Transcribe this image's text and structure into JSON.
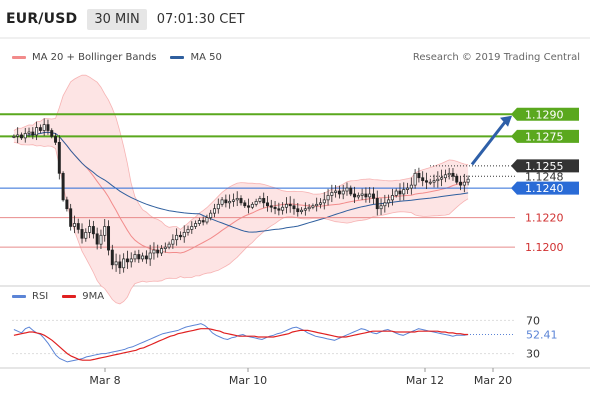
{
  "header": {
    "symbol": "EUR/USD",
    "timeframe": "30 MIN",
    "time": "07:01:30 CET"
  },
  "legend": {
    "bollinger_label": "MA 20 + Bollinger Bands",
    "ma50_label": "MA 50",
    "rsi_label": "RSI",
    "ma9_label": "9MA"
  },
  "credit": "Research © 2019 Trading Central",
  "colors": {
    "bollinger": "#f28b8b",
    "bollinger_fill": "#fde4e4",
    "ma50": "#2f5f9e",
    "resistance": "#5aa81e",
    "support": "#e88b8b",
    "pivot": "#2a6bd6",
    "arrow": "#2e5fa8",
    "rsi": "#5b84d6",
    "rsi_ma": "#e02020",
    "candle": "#222222"
  },
  "chart_data": [
    {
      "type": "candlestick",
      "title": "",
      "x_ticks": [
        "Mar 8",
        "Mar 10",
        "Mar 12",
        "Mar 20"
      ],
      "y_range": [
        1.1175,
        1.132
      ],
      "closes": [
        1.1275,
        1.1276,
        1.1274,
        1.1277,
        1.1278,
        1.1276,
        1.1281,
        1.1279,
        1.1283,
        1.1279,
        1.1275,
        1.1271,
        1.125,
        1.1232,
        1.1226,
        1.1214,
        1.1216,
        1.1212,
        1.1206,
        1.121,
        1.1214,
        1.1209,
        1.1202,
        1.1208,
        1.1214,
        1.1198,
        1.1188,
        1.119,
        1.1186,
        1.1192,
        1.119,
        1.1192,
        1.1195,
        1.1192,
        1.1194,
        1.1192,
        1.1196,
        1.1198,
        1.1196,
        1.1199,
        1.12,
        1.1202,
        1.1205,
        1.1208,
        1.1207,
        1.121,
        1.1212,
        1.1214,
        1.1216,
        1.1218,
        1.1217,
        1.122,
        1.1223,
        1.1226,
        1.1229,
        1.1232,
        1.123,
        1.1231,
        1.1232,
        1.1233,
        1.123,
        1.1228,
        1.1227,
        1.1229,
        1.1231,
        1.1233,
        1.123,
        1.1228,
        1.1227,
        1.1226,
        1.1225,
        1.1227,
        1.1229,
        1.1228,
        1.1226,
        1.1224,
        1.1225,
        1.1226,
        1.1227,
        1.1228,
        1.1229,
        1.123,
        1.1232,
        1.1235,
        1.1237,
        1.1238,
        1.1236,
        1.1238,
        1.124,
        1.1236,
        1.1234,
        1.1235,
        1.1236,
        1.1234,
        1.1236,
        1.1233,
        1.1226,
        1.1228,
        1.123,
        1.1232,
        1.1235,
        1.1238,
        1.1236,
        1.1239,
        1.124,
        1.1242,
        1.125,
        1.1247,
        1.1245,
        1.1244,
        1.1244,
        1.1245,
        1.1246,
        1.1247,
        1.1249,
        1.125,
        1.1248,
        1.1244,
        1.1242,
        1.1244,
        1.1246
      ],
      "price_lines": [
        {
          "label": "1.1290",
          "value": 1.129,
          "kind": "resistance"
        },
        {
          "label": "1.1275",
          "value": 1.1275,
          "kind": "resistance"
        },
        {
          "label": "1.1255",
          "value": 1.1255,
          "kind": "last"
        },
        {
          "label": "1.1248",
          "value": 1.1248,
          "kind": "dotted"
        },
        {
          "label": "1.1240",
          "value": 1.124,
          "kind": "pivot"
        },
        {
          "label": "1.1220",
          "value": 1.122,
          "kind": "support"
        },
        {
          "label": "1.1200",
          "value": 1.12,
          "kind": "support"
        }
      ],
      "series": [
        {
          "name": "MA 20 + Bollinger Bands"
        },
        {
          "name": "MA 50"
        }
      ]
    },
    {
      "type": "line",
      "title": "",
      "y_range": [
        15,
        85
      ],
      "y_ticks": [
        "70",
        "30"
      ],
      "last_value": "52.41",
      "series": [
        {
          "name": "RSI",
          "values": [
            59,
            57,
            55,
            60,
            62,
            58,
            55,
            53,
            48,
            42,
            35,
            28,
            24,
            22,
            20,
            21,
            22,
            23,
            24,
            26,
            27,
            28,
            29,
            30,
            30,
            31,
            32,
            33,
            34,
            35,
            37,
            38,
            40,
            42,
            44,
            46,
            48,
            50,
            52,
            54,
            55,
            56,
            57,
            58,
            60,
            62,
            63,
            64,
            65,
            66,
            64,
            60,
            55,
            52,
            50,
            48,
            47,
            49,
            50,
            52,
            53,
            51,
            50,
            49,
            48,
            47,
            49,
            51,
            52,
            54,
            55,
            57,
            59,
            61,
            62,
            60,
            58,
            55,
            53,
            51,
            50,
            49,
            48,
            47,
            46,
            48,
            50,
            52,
            54,
            56,
            58,
            60,
            59,
            57,
            55,
            54,
            56,
            58,
            59,
            57,
            55,
            53,
            52,
            54,
            56,
            58,
            60,
            59,
            58,
            57,
            56,
            55,
            54,
            53,
            52,
            51,
            52,
            52,
            52,
            53
          ]
        },
        {
          "name": "9MA",
          "values": [
            52,
            53,
            54,
            55,
            56,
            56,
            55,
            54,
            52,
            49,
            46,
            42,
            38,
            34,
            30,
            27,
            25,
            23,
            22,
            22,
            22,
            23,
            24,
            25,
            26,
            27,
            28,
            29,
            30,
            31,
            32,
            33,
            34,
            36,
            37,
            39,
            41,
            43,
            45,
            47,
            49,
            51,
            52,
            54,
            55,
            56,
            57,
            58,
            59,
            60,
            60,
            60,
            59,
            58,
            57,
            55,
            54,
            53,
            52,
            51,
            51,
            51,
            51,
            51,
            50,
            50,
            50,
            50,
            50,
            51,
            52,
            53,
            54,
            56,
            57,
            58,
            58,
            58,
            57,
            56,
            55,
            54,
            53,
            52,
            51,
            50,
            50,
            50,
            51,
            52,
            53,
            54,
            55,
            56,
            57,
            57,
            57,
            57,
            57,
            57,
            56,
            56,
            56,
            56,
            56,
            56,
            57,
            57,
            57,
            57,
            57,
            57,
            56,
            56,
            55,
            55,
            54,
            54,
            53,
            53
          ]
        }
      ]
    }
  ]
}
